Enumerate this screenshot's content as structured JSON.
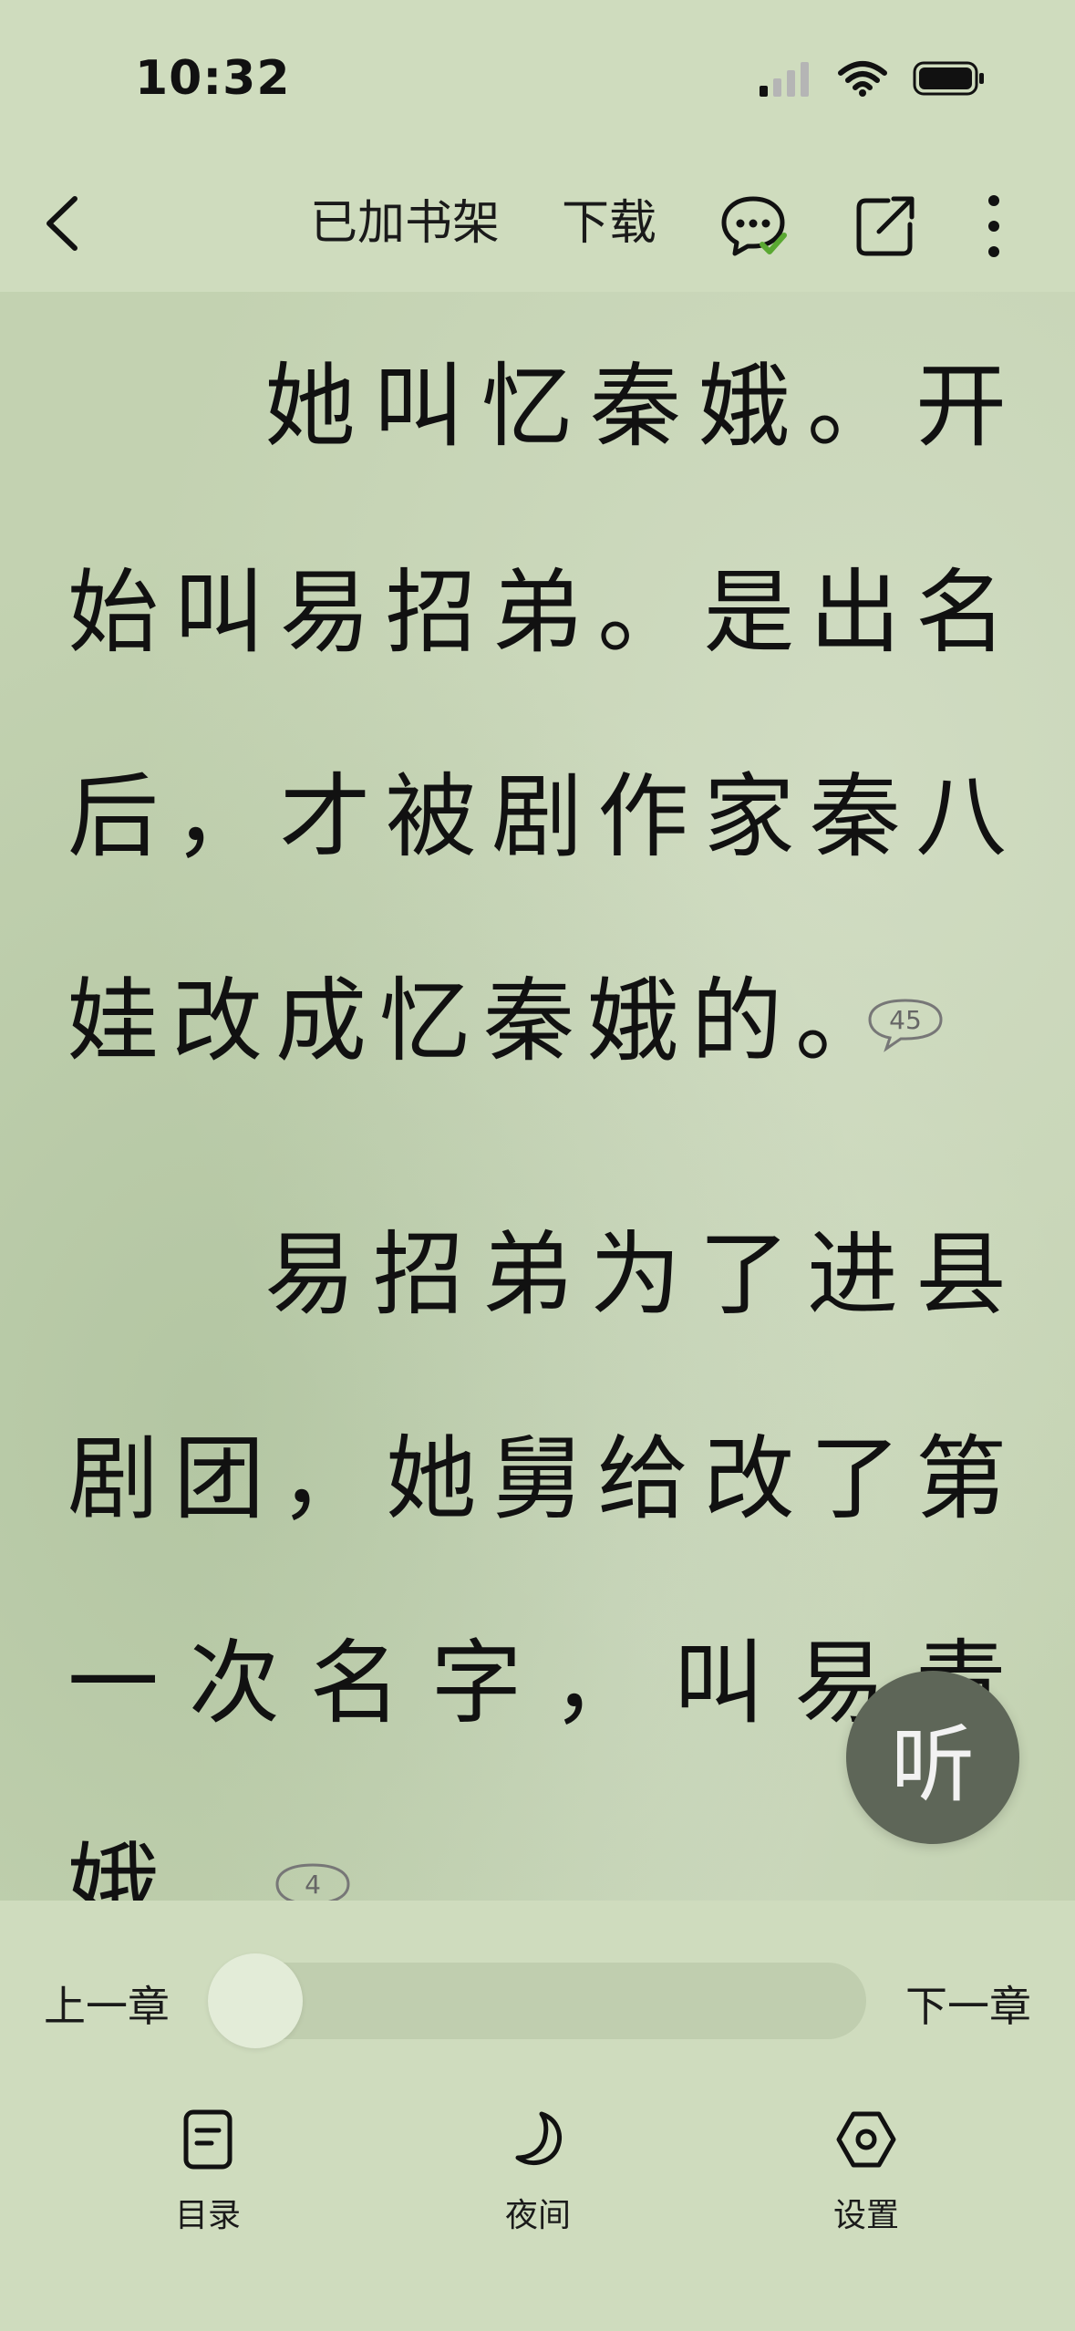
{
  "status_bar": {
    "time": "10:32"
  },
  "toolbar": {
    "shelf_label": "已加书架",
    "download_label": "下载"
  },
  "reading": {
    "lines": [
      [
        "她",
        "叫",
        "忆",
        "秦",
        "娥",
        "。",
        "开"
      ],
      [
        "始",
        "叫",
        "易",
        "招",
        "弟",
        "。",
        "是",
        "出",
        "名"
      ],
      [
        "后",
        "，",
        "才",
        "被",
        "剧",
        "作",
        "家",
        "秦",
        "八"
      ],
      [
        "娃",
        "改",
        "成",
        "忆",
        "秦",
        "娥",
        "的",
        "。"
      ],
      [
        "易",
        "招",
        "弟",
        "为",
        "了",
        "进",
        "县"
      ],
      [
        "剧",
        "团",
        "，",
        "她",
        "舅",
        "给",
        "改",
        "了",
        "第"
      ],
      [
        "一",
        "次",
        "名",
        "字",
        "，",
        "叫",
        "易",
        "青"
      ],
      [
        "娥"
      ]
    ],
    "comment_counts": [
      "45",
      "4"
    ]
  },
  "listen_button": {
    "label": "听"
  },
  "bottom": {
    "prev_chapter": "上一章",
    "next_chapter": "下一章",
    "progress": 0.0,
    "nav": [
      {
        "label": "目录",
        "icon": "catalog-icon"
      },
      {
        "label": "夜间",
        "icon": "moon-icon"
      },
      {
        "label": "设置",
        "icon": "settings-icon"
      }
    ]
  },
  "colors": {
    "background": "#cfdcbe",
    "paper": "#c3d2b1",
    "text": "#111111",
    "listen_button": "#5e6658",
    "accent_check": "#5aa832"
  }
}
